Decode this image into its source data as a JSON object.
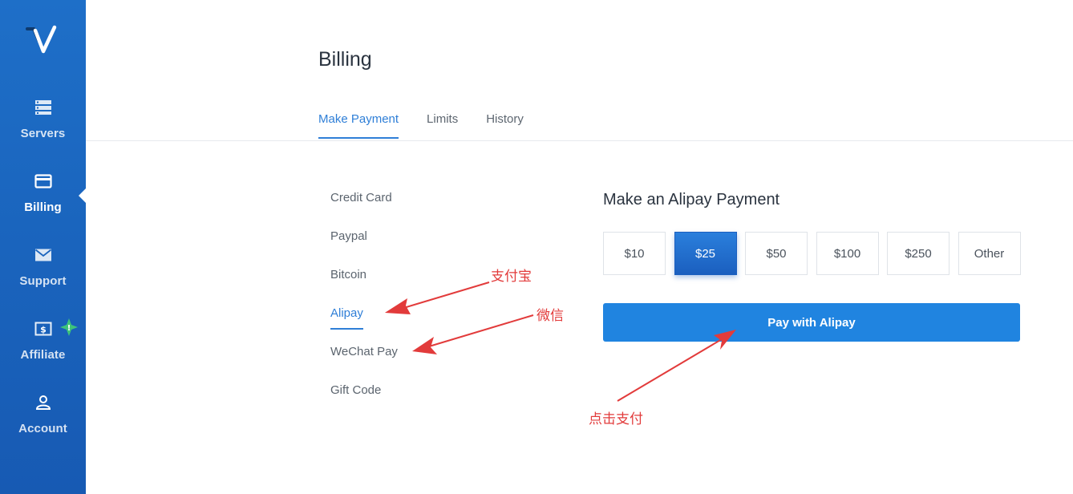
{
  "sidebar": {
    "items": [
      {
        "label": "Servers",
        "icon": "servers-icon"
      },
      {
        "label": "Billing",
        "icon": "credit-card-icon",
        "active": true
      },
      {
        "label": "Support",
        "icon": "envelope-icon"
      },
      {
        "label": "Affiliate",
        "icon": "dollar-icon",
        "badge": "!"
      },
      {
        "label": "Account",
        "icon": "user-icon"
      }
    ]
  },
  "page": {
    "title": "Billing"
  },
  "tabs": [
    {
      "label": "Make Payment",
      "active": true
    },
    {
      "label": "Limits"
    },
    {
      "label": "History"
    }
  ],
  "methods": [
    {
      "label": "Credit Card"
    },
    {
      "label": "Paypal"
    },
    {
      "label": "Bitcoin"
    },
    {
      "label": "Alipay",
      "active": true
    },
    {
      "label": "WeChat Pay"
    },
    {
      "label": "Gift Code"
    }
  ],
  "payment": {
    "title": "Make an Alipay Payment",
    "amounts": [
      "$10",
      "$25",
      "$50",
      "$100",
      "$250",
      "Other"
    ],
    "selected_amount": "$25",
    "pay_button": "Pay with Alipay"
  },
  "annotations": {
    "alipay": "支付宝",
    "wechat": "微信",
    "click_pay": "点击支付",
    "color": "#e23b3b"
  },
  "colors": {
    "accent": "#2f7fd7",
    "sidebar": "#1a64bd",
    "button": "#2084e0",
    "badge": "#3ec47a"
  }
}
